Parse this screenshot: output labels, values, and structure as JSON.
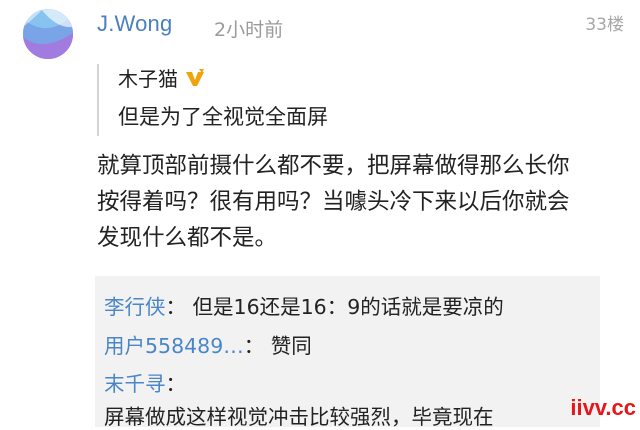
{
  "comment": {
    "username": "J.Wong",
    "time": "2小时前",
    "likes": "33楼",
    "quote": {
      "author": "木子猫",
      "text": "但是为了全视觉全面屏"
    },
    "body_lines": [
      "就算顶部前摄什么都不要，把屏幕做得那么长你",
      "按得着吗？很有用吗？当噱头冷下来以后你就会",
      "发现什么都不是。"
    ],
    "replies": [
      {
        "name": "李行侠",
        "sep": "：",
        "text": "但是16还是16：9的话就是要凉的"
      },
      {
        "name": "用户558489…",
        "sep": "：",
        "text": "赞同"
      },
      {
        "name": "末千寻",
        "sep": "：",
        "text": ""
      },
      {
        "name": "",
        "sep": "",
        "text": "屏幕做成这样视觉冲击比较强烈，毕竟现在"
      }
    ]
  },
  "watermark": "iivv.cc",
  "colors": {
    "username": "#4a7fc1",
    "reply_name": "#4a86c8",
    "reply_bg": "#f2f2f2",
    "watermark": "#e8151b",
    "badge": "#f0a30a"
  }
}
